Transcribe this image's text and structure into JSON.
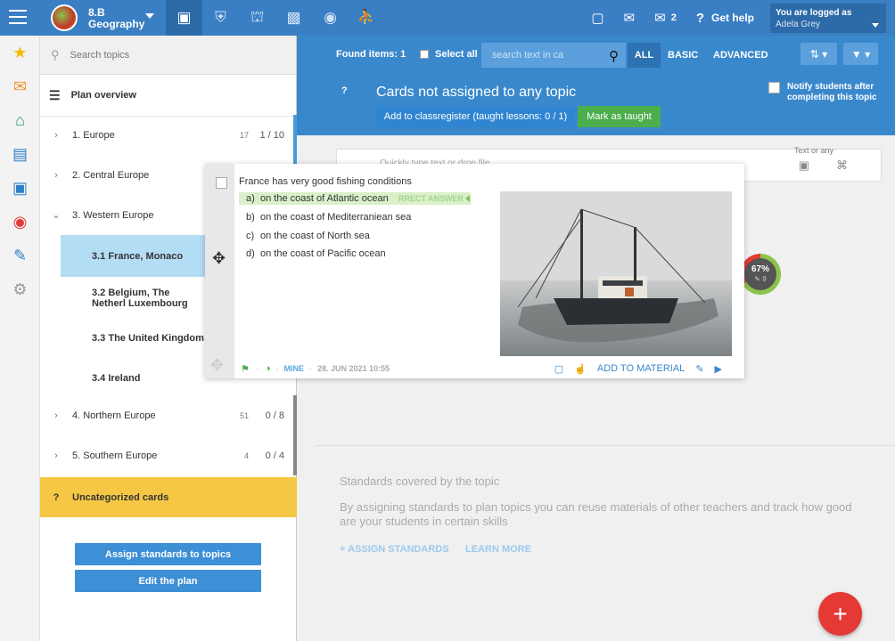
{
  "topbar": {
    "class_name_line1": "8.B",
    "class_name_line2": "Geography",
    "messages_count": "2",
    "help_label": "Get help",
    "logged_label": "You are logged as",
    "user_name": "Adela Grey"
  },
  "sidebar": {
    "search_placeholder": "Search topics",
    "plan_overview": "Plan overview",
    "topics": [
      {
        "label": "1. Europe",
        "cnt1": "17",
        "cnt2": "1 / 10"
      },
      {
        "label": "2. Central Europe",
        "cnt1": "",
        "cnt2": ""
      },
      {
        "label": "3. Western Europe",
        "cnt1": "",
        "cnt2": ""
      },
      {
        "label": "4. Northern Europe",
        "cnt1": "51",
        "cnt2": "0 / 8"
      },
      {
        "label": "5. Southern Europe",
        "cnt1": "4",
        "cnt2": "0 / 4"
      }
    ],
    "subtopics": [
      {
        "label": "3.1  France, Monaco"
      },
      {
        "label": "3.2  Belgium, The Netherl Luxembourg"
      },
      {
        "label": "3.3  The United Kingdom"
      },
      {
        "label": "3.4  Ireland"
      }
    ],
    "uncat_q": "?",
    "uncategorized": "Uncategorized cards",
    "assign_btn": "Assign standards to topics",
    "edit_btn": "Edit the plan"
  },
  "main": {
    "found": "Found items: 1",
    "select_all": "Select all",
    "search_placeholder": "search text in ca",
    "filters": [
      "ALL",
      "BASIC",
      "ADVANCED"
    ],
    "qmark": "?",
    "title": "Cards not assigned to any topic",
    "notify": "Notify students after completing this topic",
    "add_btn": "Add to classregister (taught lessons: 0 / 1)",
    "mark_btn": "Mark as taught",
    "quicktype": "Quickly type text or drop file",
    "quicktype_right": "Text or any",
    "std_title": "Standards covered by the topic",
    "std_desc": "By assigning standards to plan topics you can reuse materials of other teachers and track how good are your students in certain skills",
    "assign_standards": "+ ASSIGN STANDARDS",
    "learn_more": "LEARN MORE",
    "fab": "+"
  },
  "card": {
    "question": "France has very good fishing conditions",
    "answers": [
      {
        "letter": "a)",
        "text": "on the coast of Atlantic ocean",
        "correct": true
      },
      {
        "letter": "b)",
        "text": "on the coast of Mediterraniean sea",
        "correct": false
      },
      {
        "letter": "c)",
        "text": "on the coast of North sea",
        "correct": false
      },
      {
        "letter": "d)",
        "text": "on the coast of Pacific ocean",
        "correct": false
      }
    ],
    "correct_tag": "RRECT ANSWER",
    "mine": "MINE",
    "date": "28. JUN 2021 10:55",
    "add_to_material": "ADD TO MATERIAL"
  },
  "stats": {
    "percent": "67%",
    "edits": "9",
    "percent_value": 67
  }
}
